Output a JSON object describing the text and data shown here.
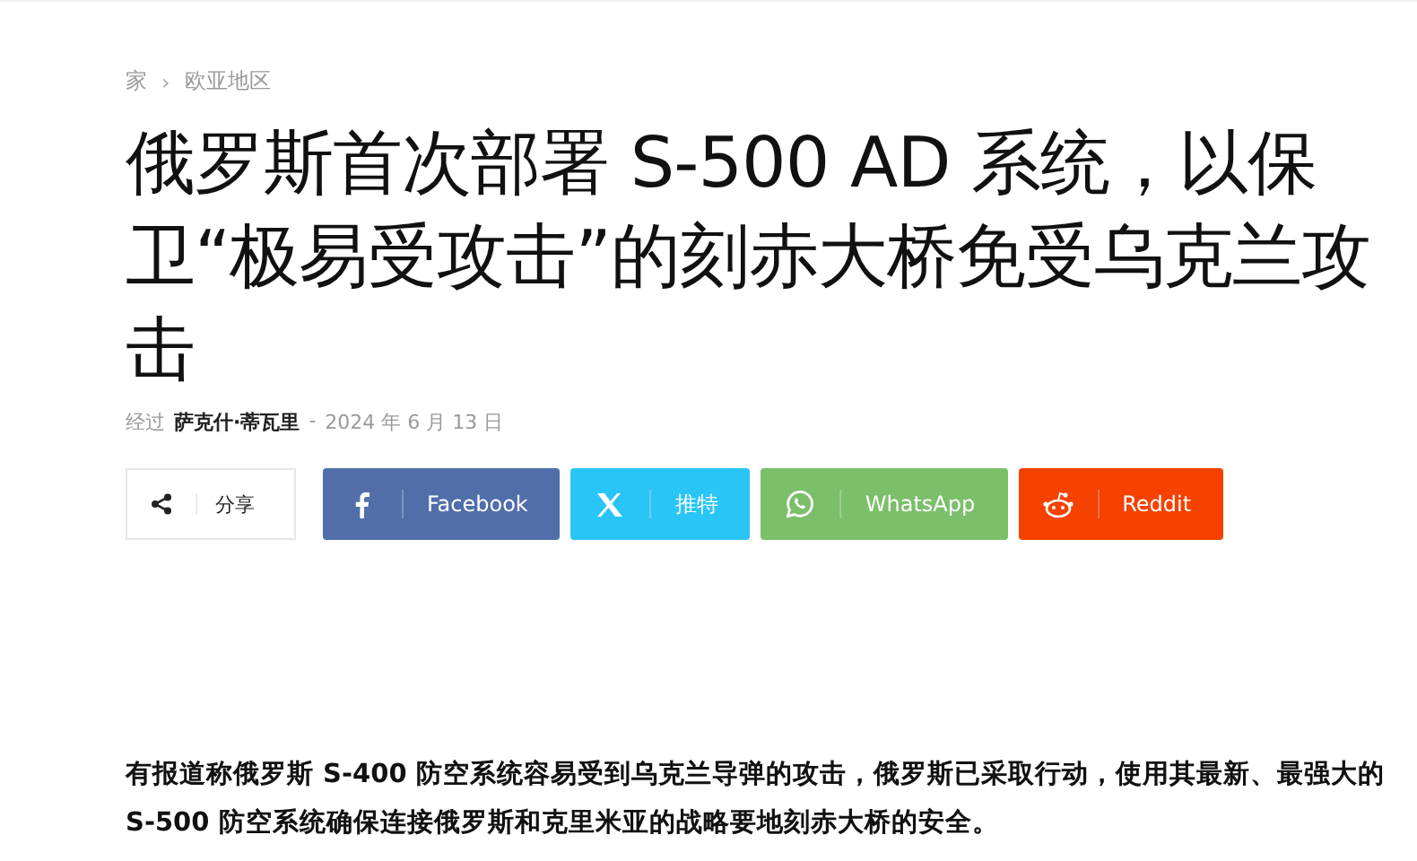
{
  "breadcrumb": [
    "家",
    "欧亚地区"
  ],
  "breadcrumb_separator": "›",
  "title": "俄罗斯首次部署 S-500 AD 系统，以保卫“极易受攻击”的刻赤大桥免受乌克兰攻击",
  "meta": {
    "by": "经过",
    "author": "萨克什·蒂瓦里",
    "separator": "-",
    "date": "2024 年 6 月 13 日"
  },
  "share": {
    "label": "分享"
  },
  "share_buttons": [
    {
      "kind": "facebook",
      "label": "Facebook",
      "color": "#516eab"
    },
    {
      "kind": "x",
      "label": "推特",
      "color": "#29c5f6"
    },
    {
      "kind": "whatsapp",
      "label": "WhatsApp",
      "color": "#7bbf6a"
    },
    {
      "kind": "reddit",
      "label": "Reddit",
      "color": "#f54200"
    }
  ],
  "paragraph": "有报道称俄罗斯 S-400 防空系统容易受到乌克兰导弹的攻击，俄罗斯已采取行动，使用其最新、最强大的 S-500 防空系统确保连接俄罗斯和克里米亚的战略要地刻赤大桥的安全。"
}
